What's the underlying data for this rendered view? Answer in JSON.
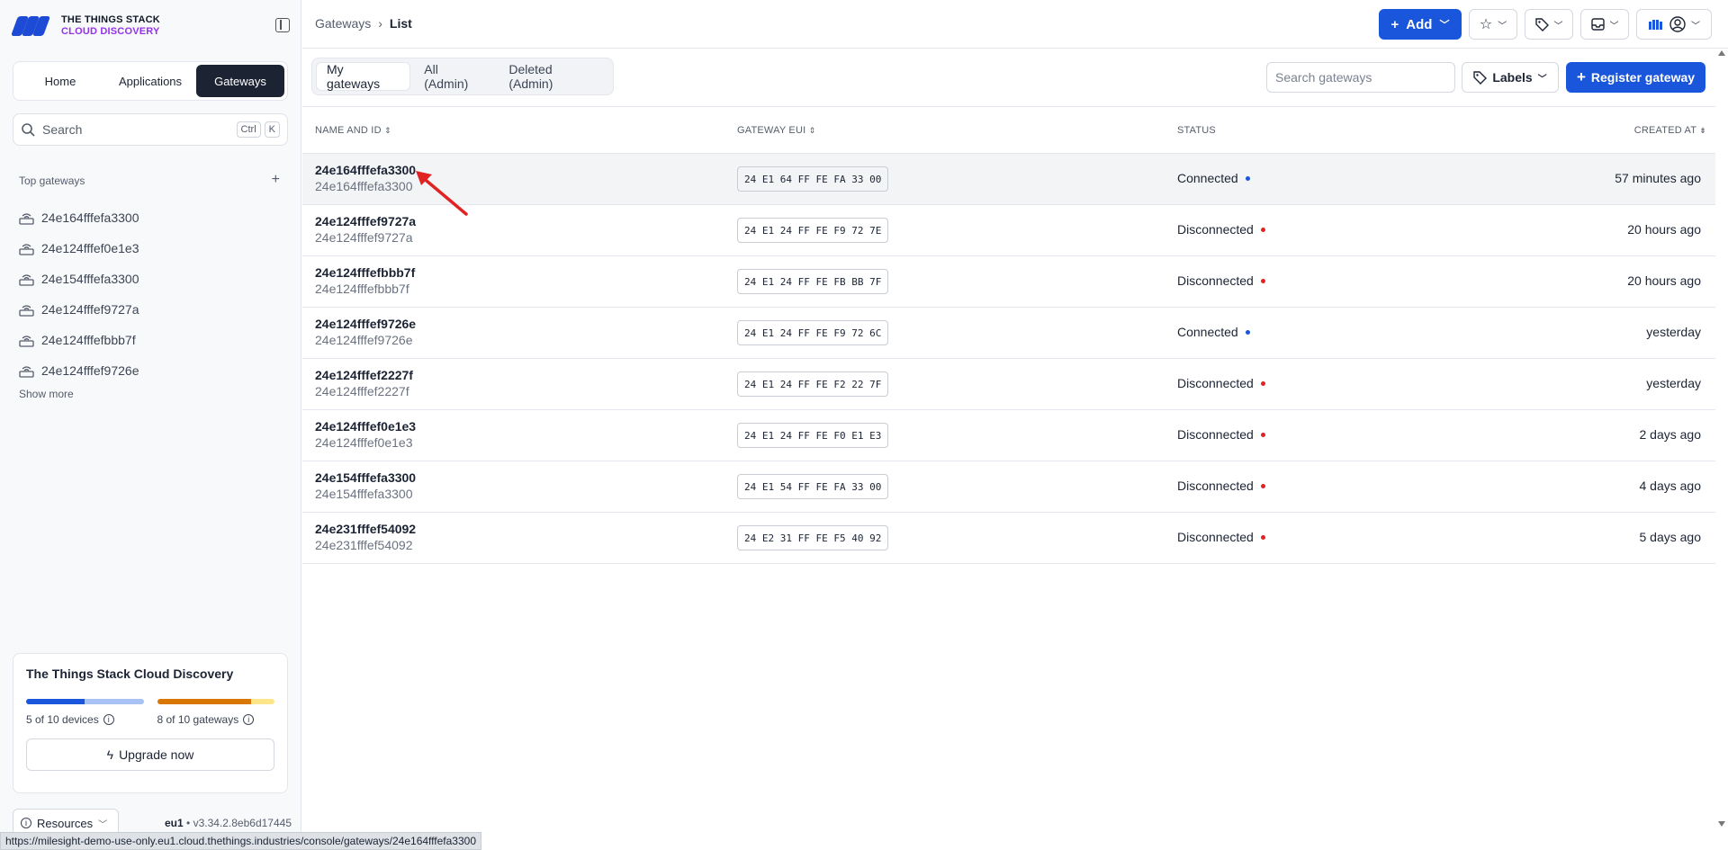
{
  "brand": {
    "line1": "THE THINGS STACK",
    "line2": "CLOUD DISCOVERY",
    "accent": "#1a56db",
    "secondary": "#9333ea"
  },
  "nav": {
    "tabs": [
      {
        "label": "Home"
      },
      {
        "label": "Applications"
      },
      {
        "label": "Gateways",
        "active": true
      }
    ]
  },
  "side_search": {
    "placeholder": "Search",
    "shortcut1": "Ctrl",
    "shortcut2": "K"
  },
  "top_gateways": {
    "heading": "Top gateways",
    "items": [
      "24e164fffefa3300",
      "24e124fffef0e1e3",
      "24e154fffefa3300",
      "24e124fffef9727a",
      "24e124fffefbbb7f",
      "24e124fffef9726e"
    ],
    "show_more": "Show more"
  },
  "plan": {
    "title": "The Things Stack Cloud Discovery",
    "devices_label": "5 of 10 devices",
    "devices_fraction": 0.5,
    "gateways_label": "8 of 10 gateways",
    "gateways_fraction": 0.8,
    "upgrade_label": "Upgrade now"
  },
  "footer": {
    "resources_label": "Resources",
    "cluster": "eu1",
    "version": "v3.34.2.8eb6d17445"
  },
  "status_url": "https://milesight-demo-use-only.eu1.cloud.thethings.industries/console/gateways/24e164fffefa3300",
  "breadcrumb": {
    "parent": "Gateways",
    "current": "List"
  },
  "header": {
    "add_label": "Add"
  },
  "filters": {
    "tabs": [
      {
        "label": "My gateways",
        "active": true
      },
      {
        "label": "All (Admin)"
      },
      {
        "label": "Deleted (Admin)"
      }
    ]
  },
  "toolbar": {
    "search_placeholder": "Search gateways",
    "labels_label": "Labels",
    "register_label": "Register gateway"
  },
  "table": {
    "columns": {
      "name": "Name and ID",
      "eui": "Gateway EUI",
      "status": "Status",
      "created": "Created at"
    },
    "rows": [
      {
        "name": "24e164fffefa3300",
        "id": "24e164fffefa3300",
        "eui": "24 E1 64 FF FE FA 33 00",
        "status": "Connected",
        "created": "57 minutes ago"
      },
      {
        "name": "24e124fffef9727a",
        "id": "24e124fffef9727a",
        "eui": "24 E1 24 FF FE F9 72 7E",
        "status": "Disconnected",
        "created": "20 hours ago"
      },
      {
        "name": "24e124fffefbbb7f",
        "id": "24e124fffefbbb7f",
        "eui": "24 E1 24 FF FE FB BB 7F",
        "status": "Disconnected",
        "created": "20 hours ago"
      },
      {
        "name": "24e124fffef9726e",
        "id": "24e124fffef9726e",
        "eui": "24 E1 24 FF FE F9 72 6C",
        "status": "Connected",
        "created": "yesterday"
      },
      {
        "name": "24e124fffef2227f",
        "id": "24e124fffef2227f",
        "eui": "24 E1 24 FF FE F2 22 7F",
        "status": "Disconnected",
        "created": "yesterday"
      },
      {
        "name": "24e124fffef0e1e3",
        "id": "24e124fffef0e1e3",
        "eui": "24 E1 24 FF FE F0 E1 E3",
        "status": "Disconnected",
        "created": "2 days ago"
      },
      {
        "name": "24e154fffefa3300",
        "id": "24e154fffefa3300",
        "eui": "24 E1 54 FF FE FA 33 00",
        "status": "Disconnected",
        "created": "4 days ago"
      },
      {
        "name": "24e231fffef54092",
        "id": "24e231fffef54092",
        "eui": "24 E2 31 FF FE F5 40 92",
        "status": "Disconnected",
        "created": "5 days ago"
      }
    ]
  },
  "status_colors": {
    "Connected": "#1a56db",
    "Disconnected": "#e02424"
  }
}
